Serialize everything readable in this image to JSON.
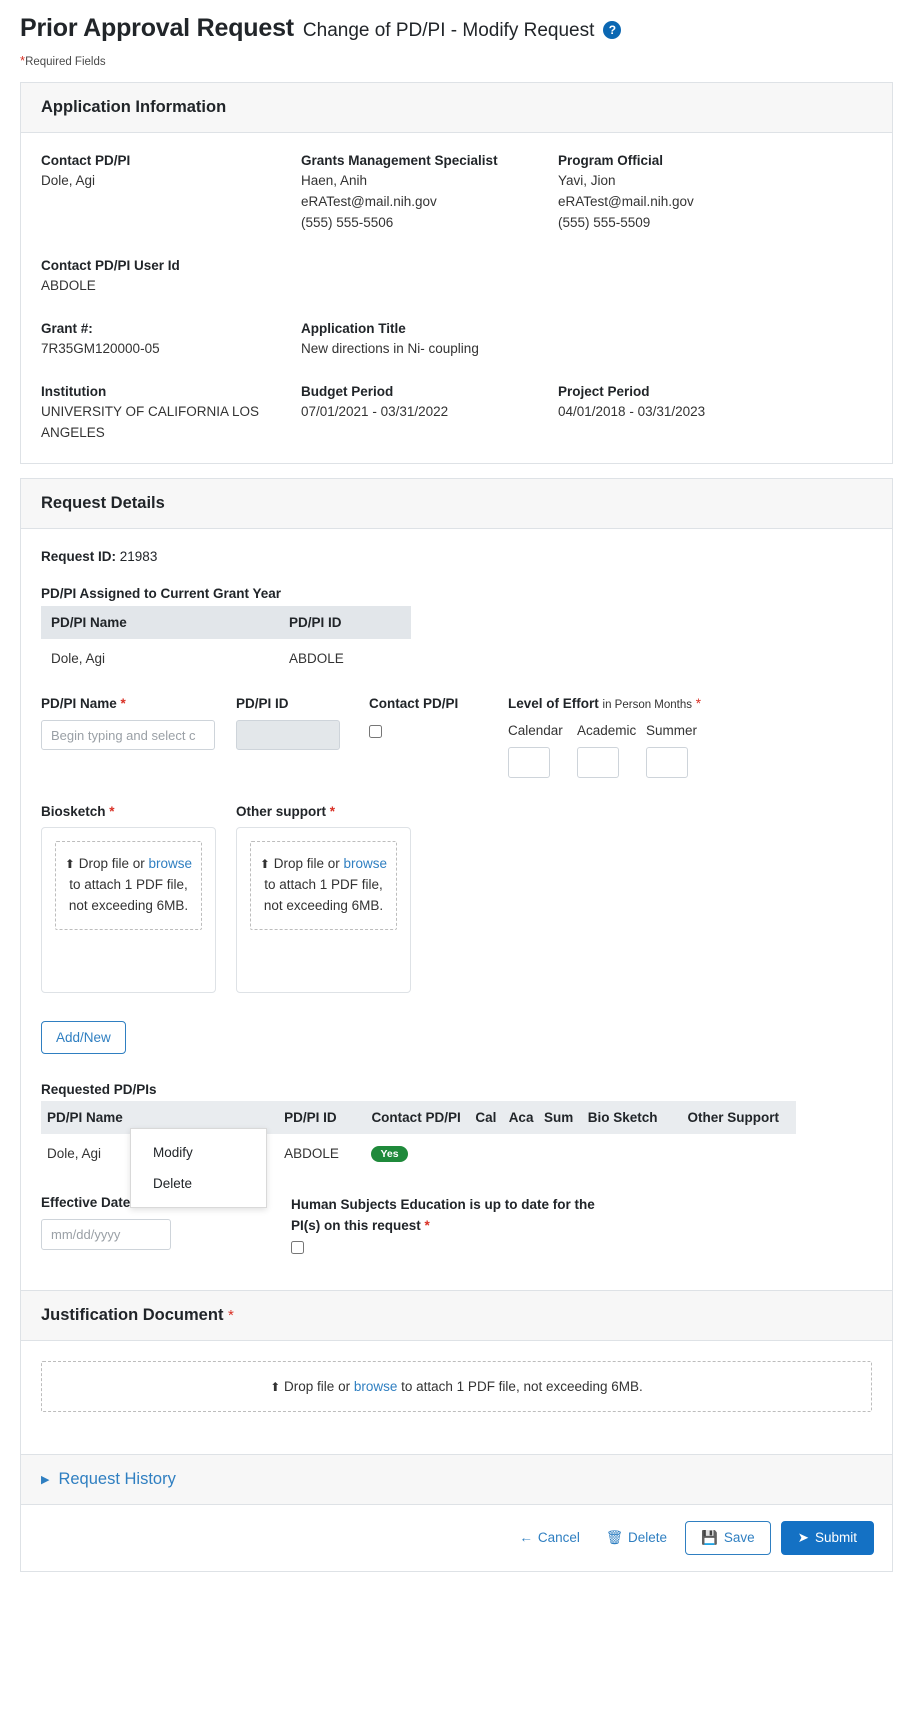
{
  "header": {
    "title_main": "Prior Approval Request",
    "title_sub": "Change of PD/PI - Modify Request",
    "help_icon": "help-circle-icon",
    "required_note": "Required Fields",
    "asterisk": "*"
  },
  "application_information": {
    "section_title": "Application Information",
    "fields": [
      {
        "label": "Contact PD/PI",
        "lines": [
          "Dole, Agi"
        ]
      },
      {
        "label": "Grants Management Specialist",
        "lines": [
          "Haen, Anih",
          "eRATest@mail.nih.gov",
          "(555) 555-5506"
        ]
      },
      {
        "label": "Program Official",
        "lines": [
          "Yavi, Jion",
          "eRATest@mail.nih.gov",
          "(555) 555-5509"
        ]
      },
      {
        "label": "Contact PD/PI User Id",
        "lines": [
          "ABDOLE"
        ]
      },
      {
        "label": "Grant #:",
        "lines": [
          "7R35GM120000-05"
        ]
      },
      {
        "label": "Application Title",
        "lines": [
          "New directions in Ni- coupling"
        ]
      },
      {
        "label": "Institution",
        "lines": [
          "UNIVERSITY OF CALIFORNIA LOS ANGELES"
        ]
      },
      {
        "label": "Budget Period",
        "lines": [
          "07/01/2021 - 03/31/2022"
        ]
      },
      {
        "label": "Project Period",
        "lines": [
          "04/01/2018 - 03/31/2023"
        ]
      }
    ]
  },
  "request_details": {
    "section_title": "Request Details",
    "request_id_label": "Request ID:",
    "request_id_value": "21983",
    "assigned_title": "PD/PI Assigned to Current Grant Year",
    "assigned_table": {
      "headers": [
        "PD/PI Name",
        "PD/PI ID"
      ],
      "rows": [
        [
          "Dole, Agi",
          "ABDOLE"
        ]
      ]
    },
    "form": {
      "name_label": "PD/PI Name",
      "name_placeholder": "Begin typing and select c",
      "name_value": "",
      "id_label": "PD/PI ID",
      "id_value": "",
      "contact_label": "Contact PD/PI",
      "contact_checked": false
    },
    "level_of_effort": {
      "title": "Level of Effort",
      "subtitle": "in Person Months",
      "columns": [
        "Calendar",
        "Academic",
        "Summer"
      ],
      "values": [
        "",
        "",
        ""
      ]
    },
    "attachments": [
      {
        "label": "Biosketch",
        "required": true,
        "drop_prefix": "Drop file or",
        "browse": "browse",
        "drop_suffix": "to attach 1 PDF file, not exceeding 6MB.",
        "icon": "upload-icon"
      },
      {
        "label": "Other support",
        "required": true,
        "drop_prefix": "Drop file or",
        "browse": "browse",
        "drop_suffix": "to attach 1 PDF file, not exceeding 6MB.",
        "icon": "upload-icon"
      }
    ],
    "add_new_label": "Add/New",
    "requested_title": "Requested PD/PIs",
    "requested_table": {
      "headers": [
        "PD/PI Name",
        "PD/PI ID",
        "Contact PD/PI",
        "Cal",
        "Aca",
        "Sum",
        "Bio Sketch",
        "Other Support"
      ],
      "rows": [
        {
          "name": "Dole, Agi",
          "menu_icon": "kebab-menu-icon",
          "id": "ABDOLE",
          "contact": "Yes",
          "cal": "",
          "aca": "",
          "sum": "",
          "bio_sketch": "",
          "other_support": ""
        }
      ]
    },
    "row_menu": {
      "items": [
        "Modify",
        "Delete"
      ]
    },
    "effective_date": {
      "label": "Effective Date",
      "placeholder": "mm/dd/yyyy",
      "value": ""
    },
    "human_subjects": {
      "text": "Human Subjects Education is up to date for the PI(s) on this request",
      "required": true,
      "checked": false
    }
  },
  "justification": {
    "section_title": "Justification Document",
    "required": true,
    "icon": "upload-icon",
    "drop_prefix": "Drop file or",
    "browse": "browse",
    "drop_suffix": "to attach 1 PDF file, not exceeding 6MB."
  },
  "request_history": {
    "label": "Request History",
    "caret": "caret-right-icon",
    "expanded": false
  },
  "footer": {
    "cancel": "Cancel",
    "cancel_icon": "arrow-left-icon",
    "delete": "Delete",
    "delete_icon": "trash-icon",
    "save": "Save",
    "save_icon": "floppy-disk-icon",
    "submit": "Submit",
    "submit_icon": "paper-plane-icon"
  },
  "colors": {
    "accent": "#2f7fc1",
    "primary_button": "#1471c4",
    "required": "#d93025",
    "badge_yes": "#1f8a3b",
    "header_bg": "#f7f7f7",
    "table_header_bg": "#e9ecef"
  }
}
